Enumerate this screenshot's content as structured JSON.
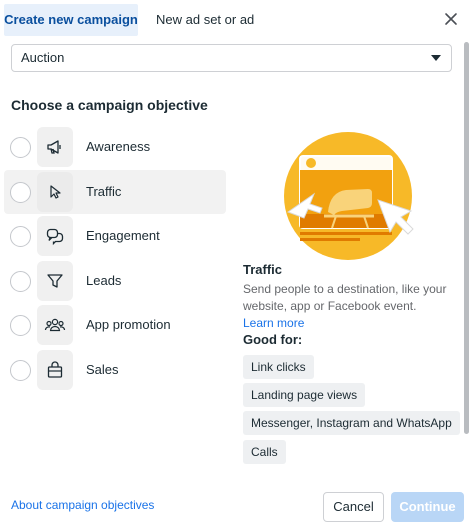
{
  "tabs": {
    "active": "Create new campaign",
    "inactive": "New ad set or ad"
  },
  "buying_type": {
    "value": "Auction"
  },
  "objectives": {
    "heading": "Choose a campaign objective",
    "items": [
      {
        "label": "Awareness",
        "icon": "megaphone-icon",
        "selected": false
      },
      {
        "label": "Traffic",
        "icon": "cursor-icon",
        "selected": true
      },
      {
        "label": "Engagement",
        "icon": "chat-icon",
        "selected": false
      },
      {
        "label": "Leads",
        "icon": "funnel-icon",
        "selected": false
      },
      {
        "label": "App promotion",
        "icon": "people-icon",
        "selected": false
      },
      {
        "label": "Sales",
        "icon": "shopping-bag-icon",
        "selected": false
      }
    ]
  },
  "detail": {
    "title": "Traffic",
    "description": "Send people to a destination, like your website, app or Facebook event.",
    "learn_more": "Learn more",
    "good_for_label": "Good for:",
    "good_for": [
      "Link clicks",
      "Landing page views",
      "Messenger, Instagram and WhatsApp",
      "Calls"
    ]
  },
  "footer": {
    "about_link": "About campaign objectives",
    "cancel": "Cancel",
    "continue": "Continue"
  },
  "colors": {
    "accent": "#1a73e8",
    "active_tab_bg": "#e7f0fb",
    "continue_disabled": "#b9d6f6",
    "illustration_yellow": "#f7b928",
    "illustration_orange": "#e07b00"
  }
}
